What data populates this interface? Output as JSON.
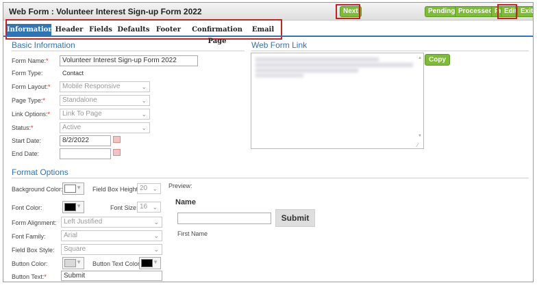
{
  "window": {
    "title": "Web Form : Volunteer Interest Sign-up Form 2022"
  },
  "toolbar": {
    "next": "Next",
    "pending": "Pending",
    "processed": "Processed",
    "preview": "Preview",
    "edit": "Edit",
    "exit": "Exit"
  },
  "tabs": [
    {
      "label": "Information",
      "active": true
    },
    {
      "label": "Header"
    },
    {
      "label": "Fields"
    },
    {
      "label": "Defaults"
    },
    {
      "label": "Footer"
    },
    {
      "label": "Confirmation Page"
    },
    {
      "label": "Email"
    }
  ],
  "basic": {
    "title": "Basic Information",
    "form_name_label": "Form Name:",
    "form_name_value": "Volunteer Interest Sign-up Form 2022",
    "form_type_label": "Form Type:",
    "form_type_value": "Contact",
    "form_layout_label": "Form Layout:",
    "form_layout_value": "Mobile Responsive",
    "page_type_label": "Page Type:",
    "page_type_value": "Standalone",
    "link_options_label": "Link Options:",
    "link_options_value": "Link To Page",
    "status_label": "Status:",
    "status_value": "Active",
    "start_date_label": "Start Date:",
    "start_date_value": "8/2/2022",
    "end_date_label": "End Date:",
    "end_date_value": ""
  },
  "weblink": {
    "title": "Web Form Link",
    "copy": "Copy"
  },
  "format": {
    "title": "Format Options",
    "bg_color_label": "Background Color:",
    "bg_color": "#ffffff",
    "field_box_height_label": "Field Box Height:",
    "field_box_height_value": "20",
    "font_color_label": "Font Color:",
    "font_color": "#000000",
    "font_size_label": "Font Size:",
    "font_size_value": "16",
    "form_alignment_label": "Form Alignment:",
    "form_alignment_value": "Left Justified",
    "font_family_label": "Font Family:",
    "font_family_value": "Arial",
    "field_box_style_label": "Field Box Style:",
    "field_box_style_value": "Square",
    "button_color_label": "Button Color:",
    "button_color": "#d9d9d9",
    "button_text_color_label": "Button Text Color:",
    "button_text_color": "#000000",
    "button_text_label": "Button Text:",
    "button_text_value": "Submit"
  },
  "preview": {
    "label": "Preview:",
    "heading": "Name",
    "submit": "Submit",
    "field_caption": "First Name"
  },
  "colors": {
    "accent": "#2f74b5",
    "green": "#7cbd35",
    "red_highlight": "#cc1f1f"
  }
}
